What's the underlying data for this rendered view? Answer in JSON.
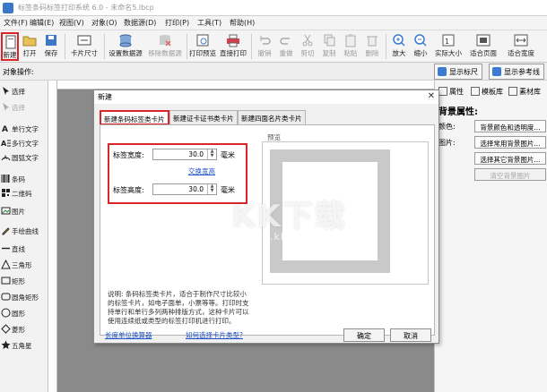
{
  "window": {
    "title": "标签条码标签打印系统 6.0 - 未命名5.lbcp"
  },
  "menu": [
    "文件(F)",
    "编辑(E)",
    "视图(V)",
    "对象(O)",
    "数据源(D)",
    "打印(P)",
    "工具(T)",
    "帮助(H)"
  ],
  "toolbar": {
    "new": "新建",
    "open": "打开",
    "save": "保存",
    "card_size": "卡片尺寸",
    "set_datasource": "设置数据源",
    "remove_datasource": "移除数据源",
    "print_preview": "打印预览",
    "direct_print": "直接打印",
    "undo": "撤销",
    "redo": "重做",
    "cut": "剪切",
    "copy": "复制",
    "paste": "粘贴",
    "delete": "删除",
    "zoom_in": "放大",
    "zoom_out": "缩小",
    "actual_size": "实际大小",
    "fit_page": "适合页面",
    "fit_width": "适合宽度"
  },
  "bar2": {
    "label": "对象操作:",
    "show_ruler": "显示标尺",
    "show_guides": "显示参考线"
  },
  "left_tools": [
    "选择",
    "选择",
    "单行文字",
    "多行文字",
    "圆弧文字",
    "条码",
    "二维码",
    "图片",
    "手绘曲线",
    "直线",
    "三角形",
    "矩形",
    "圆角矩形",
    "圆形",
    "菱形",
    "五角星"
  ],
  "right_panel": {
    "tabs": [
      "属性",
      "模板库",
      "素材库"
    ],
    "title": "背景属性:",
    "color_label": "颜色:",
    "image_label": "图片:",
    "buttons": [
      "背景颜色和透明度...",
      "选择常用背景图片...",
      "选择其它背景图片...",
      "清空背景图片"
    ]
  },
  "dialog": {
    "title": "新建",
    "tabs": [
      "新建条码标签类卡片",
      "新建证卡证书类卡片",
      "新建四面名片类卡片"
    ],
    "width_label": "标签宽度:",
    "width_value": "30.0",
    "height_label": "标签高度:",
    "height_value": "30.0",
    "unit": "毫米",
    "swap_label": "交换宽高",
    "preview_label": "预览",
    "description": "说明: 条码标签类卡片，适合于制作尺寸比较小的标签卡片，如电子面单，小票等等。打印时支持单行和单行多列两种排版方式，这种卡片可以使用连续纸或类型的标签打印机进行打印。",
    "link_tutorial": "长度单位换算器",
    "link_help": "如何选择卡片类型?",
    "ok": "确定",
    "cancel": "取消"
  },
  "watermark": {
    "text": "KK下载",
    "url": "www.kkx.net"
  }
}
